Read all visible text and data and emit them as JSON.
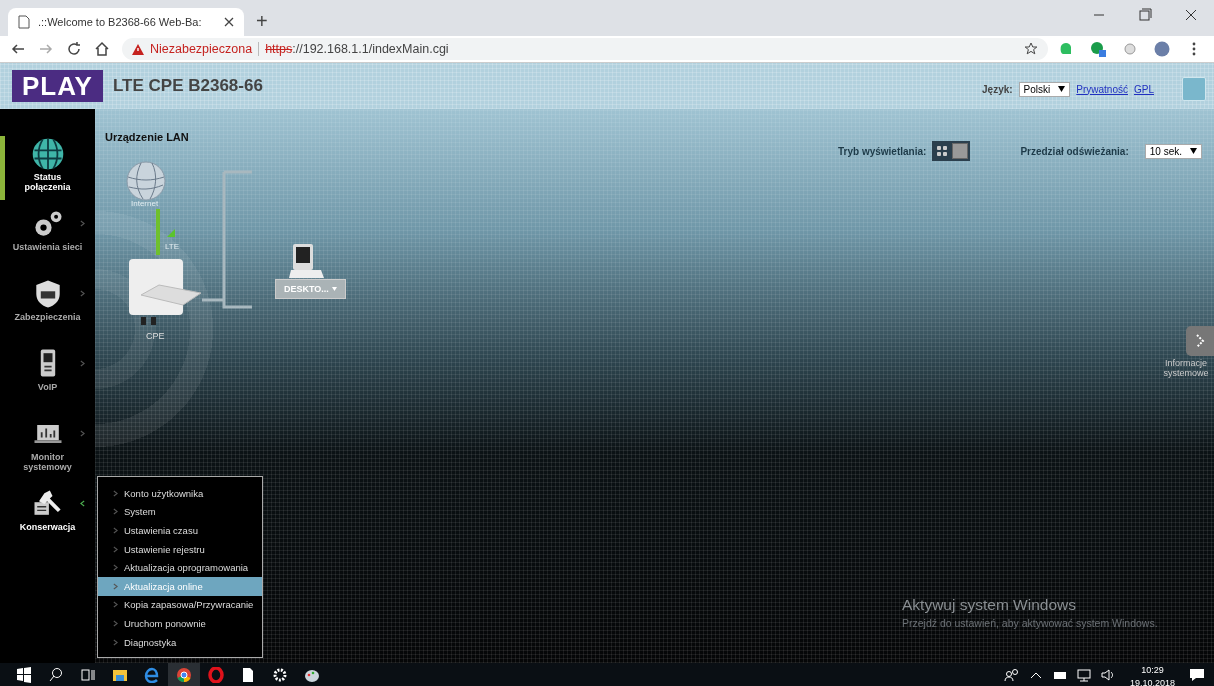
{
  "browser": {
    "tab_title": ".::Welcome to B2368-66 Web-Ba:",
    "new_tab": "+",
    "security_label": "Niezabezpieczona",
    "url_scheme": "https",
    "url_rest": "://192.168.1.1/indexMain.cgi"
  },
  "header": {
    "logo": "PLAY",
    "model": "LTE CPE B2368-66",
    "language_label": "Język:",
    "language": "Polski",
    "links": [
      "Prywatność",
      "GPL"
    ]
  },
  "sidebar": {
    "items": [
      {
        "label": "Status połączenia",
        "selected": true,
        "expanded": false
      },
      {
        "label": "Ustawienia sieci",
        "selected": false,
        "expanded": false
      },
      {
        "label": "Zabezpieczenia",
        "selected": false,
        "expanded": false
      },
      {
        "label": "VoIP",
        "selected": false,
        "expanded": false
      },
      {
        "label": "Monitor systemowy",
        "selected": false,
        "expanded": false
      },
      {
        "label": "Konserwacja",
        "selected": false,
        "expanded": true
      }
    ]
  },
  "submenu": {
    "items": [
      {
        "label": "Konto użytkownika",
        "selected": false
      },
      {
        "label": "System",
        "selected": false
      },
      {
        "label": "Ustawienia czasu",
        "selected": false
      },
      {
        "label": "Ustawienie rejestru",
        "selected": false
      },
      {
        "label": "Aktualizacja oprogramowania",
        "selected": false
      },
      {
        "label": "Aktualizacja online",
        "selected": true
      },
      {
        "label": "Kopia zapasowa/Przywracanie",
        "selected": false
      },
      {
        "label": "Uruchom ponownie",
        "selected": false
      },
      {
        "label": "Diagnostyka",
        "selected": false
      }
    ]
  },
  "content": {
    "section_title": "Urządzenie LAN",
    "display_mode_label": "Tryb wyświetlania:",
    "display_modes": [
      {
        "selected": true
      },
      {
        "selected": false
      }
    ],
    "refresh_label": "Przedział odświeżania:",
    "refresh_value": "10 sek."
  },
  "diagram": {
    "internet_label": "Internet",
    "lte_label": "LTE",
    "cpe_label": "CPE",
    "device_label": "DESKTO..."
  },
  "side_panel": {
    "label": "Informacje systemowe"
  },
  "activation": {
    "title": "Aktywuj system Windows",
    "subtitle": "Przejdź do ustawień, aby aktywować system Windows."
  },
  "taskbar": {
    "time": "10:29",
    "date": "19.10.2018"
  }
}
